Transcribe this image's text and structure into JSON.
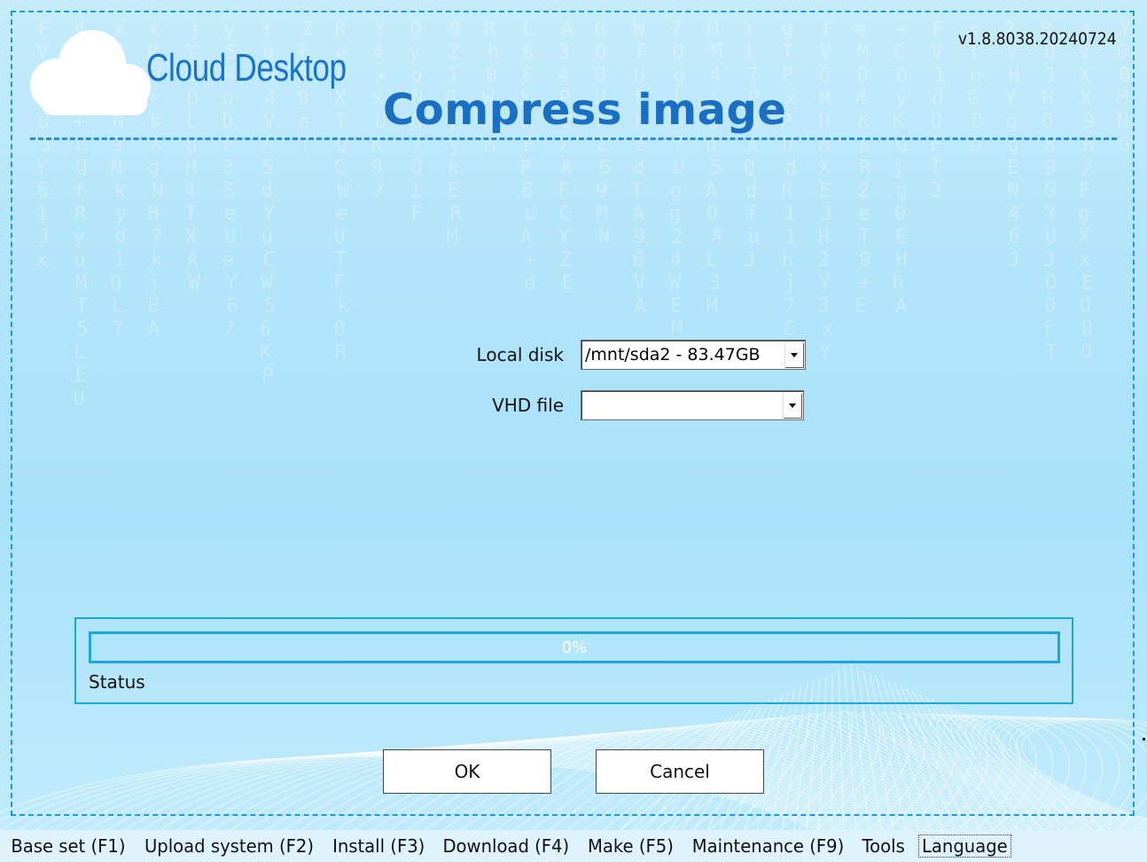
{
  "brand": {
    "name": "Cloud Desktop",
    "version": "v1.8.8038.20240724",
    "logo_icon": "cloud-icon"
  },
  "page": {
    "title": "Compress image"
  },
  "form": {
    "local_disk": {
      "label": "Local disk",
      "value": "/mnt/sda2 - 83.47GB"
    },
    "vhd_file": {
      "label": "VHD file",
      "value": ""
    }
  },
  "progress": {
    "value": 0,
    "text": "0%",
    "status_label": "Status"
  },
  "buttons": {
    "ok": "OK",
    "cancel": "Cancel"
  },
  "menu": {
    "items": [
      "Base set (F1)",
      "Upload system (F2)",
      "Install (F3)",
      "Download (F4)",
      "Make (F5)",
      "Maintenance (F9)",
      "Tools",
      "Language"
    ],
    "focused": "Language"
  },
  "colors": {
    "accent": "#1a73c9",
    "frame": "#1d9ad9",
    "progress": "#1aa7df",
    "background": "#b3e5fa",
    "menubar": "#dff3fc"
  }
}
